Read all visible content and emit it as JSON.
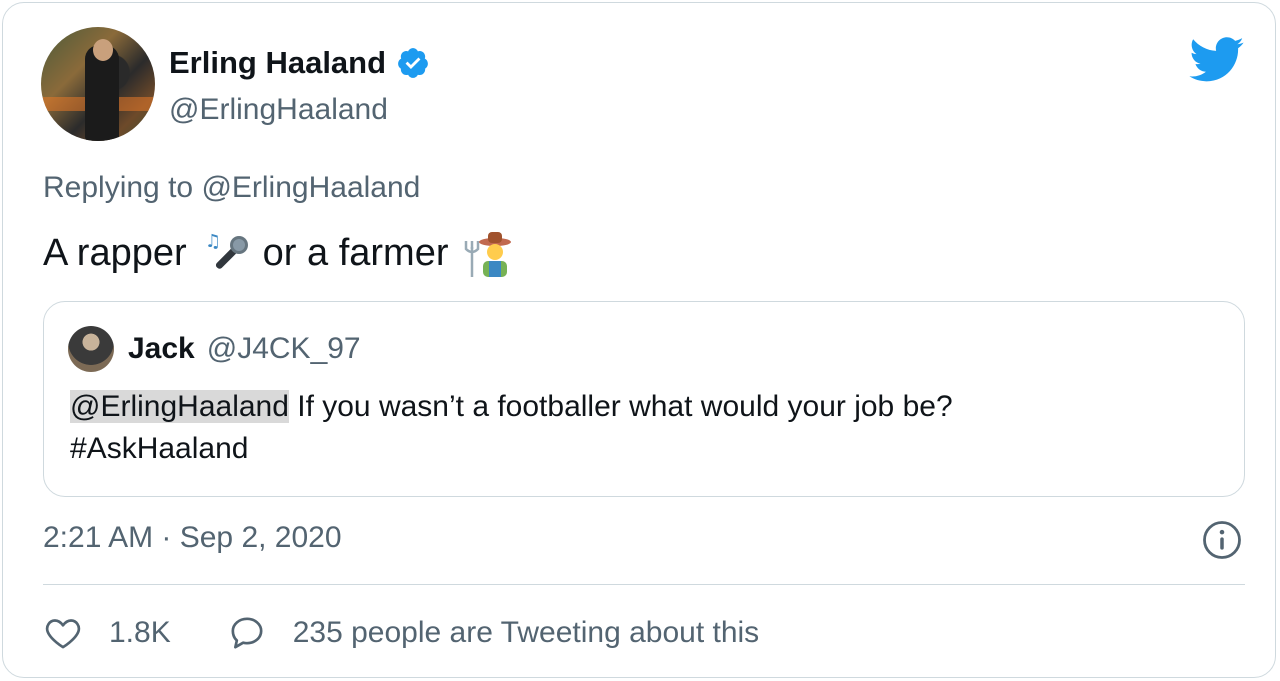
{
  "tweet": {
    "display_name": "Erling Haaland",
    "handle": "@ErlingHaaland",
    "replying_prefix": "Replying to",
    "replying_handle": "@ErlingHaaland",
    "text_part1": "A rapper",
    "emoji1": "microphone-emoji",
    "text_part2": "or a farmer",
    "emoji2": "farmer-emoji",
    "timestamp": "2:21 AM · Sep 2, 2020"
  },
  "quoted": {
    "name": "Jack",
    "handle": "@J4CK_97",
    "mention": "@ErlingHaaland",
    "text": " If you wasn’t a footballer what would your job be?",
    "hashtag": "#AskHaaland"
  },
  "actions": {
    "likes": "1.8K",
    "conversation": "235 people are Tweeting about this"
  },
  "colors": {
    "twitter_blue": "#1d9bf0",
    "secondary_text": "#536471",
    "border": "#cfd9de"
  }
}
